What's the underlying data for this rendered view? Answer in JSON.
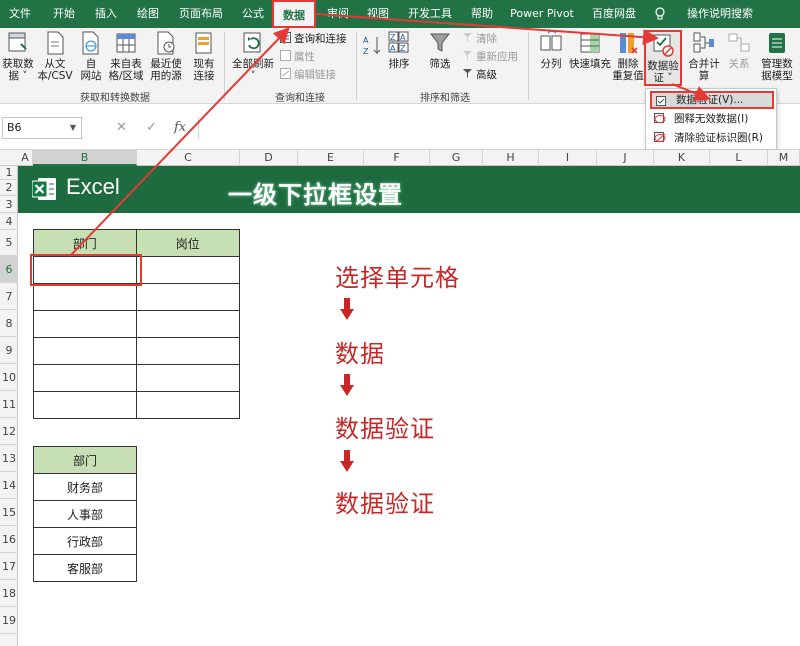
{
  "menu": {
    "tabs": [
      {
        "label": "文件",
        "active": false
      },
      {
        "label": "开始",
        "active": false
      },
      {
        "label": "插入",
        "active": false
      },
      {
        "label": "绘图",
        "active": false
      },
      {
        "label": "页面布局",
        "active": false
      },
      {
        "label": "公式",
        "active": false
      },
      {
        "label": "数据",
        "active": true
      },
      {
        "label": "审阅",
        "active": false
      },
      {
        "label": "视图",
        "active": false
      },
      {
        "label": "开发工具",
        "active": false
      },
      {
        "label": "帮助",
        "active": false
      },
      {
        "label": "Power Pivot",
        "active": false
      },
      {
        "label": "百度网盘",
        "active": false
      },
      {
        "label": "操作说明搜索",
        "active": false
      }
    ]
  },
  "ribbon": {
    "get_data": {
      "line1": "获取数",
      "line2": "据 ˅"
    },
    "from_text": {
      "line1": "从文",
      "line2": "本/CSV"
    },
    "from_web": {
      "line1": "自",
      "line2": "网站"
    },
    "from_table": {
      "line1": "来自表",
      "line2": "格/区域"
    },
    "recent_sources": {
      "line1": "最近使",
      "line2": "用的源"
    },
    "existing_conn": {
      "line1": "现有",
      "line2": "连接"
    },
    "group_get": "获取和转换数据",
    "refresh_all": {
      "line1": "全部刷新",
      "line2": "˅"
    },
    "queries_conn": "查询和连接",
    "properties": "属性",
    "edit_links": "编辑链接",
    "group_queries": "查询和连接",
    "sort": "排序",
    "filter": "筛选",
    "clear": "清除",
    "reapply": "重新应用",
    "advanced": "高级",
    "group_sort": "排序和筛选",
    "split": "分列",
    "flash_fill": "快速填充",
    "remove_dup": {
      "line1": "删除",
      "line2": "重复值"
    },
    "data_validation": {
      "line1": "数据验",
      "line2": "证 ˅"
    },
    "consolidate": "合并计算",
    "relations": "关系",
    "data_model": {
      "line1": "管理数",
      "line2": "据模型"
    }
  },
  "dropdown": {
    "items": [
      {
        "label": "数据验证(V)...",
        "highlighted": true
      },
      {
        "label": "圈释无效数据(I)",
        "highlighted": false
      },
      {
        "label": "清除验证标识圈(R)",
        "highlighted": false
      }
    ]
  },
  "formula_bar": {
    "name_box": "B6",
    "cancel": "✕",
    "enter": "✓",
    "fx": "fx",
    "value": ""
  },
  "columns": [
    "A",
    "B",
    "C",
    "D",
    "E",
    "F",
    "G",
    "H",
    "I",
    "J",
    "K",
    "L",
    "M"
  ],
  "selected_column": "B",
  "rows": [
    "1",
    "2",
    "3",
    "4",
    "5",
    "6",
    "7",
    "8",
    "9",
    "10",
    "11",
    "12",
    "13",
    "14",
    "15",
    "16",
    "17",
    "18",
    "19"
  ],
  "selected_row": "6",
  "banner": {
    "brand": "Excel",
    "title": "一级下拉框设置"
  },
  "table1": {
    "headers": [
      "部门",
      "岗位"
    ],
    "rows": [
      [
        "",
        ""
      ],
      [
        "",
        ""
      ],
      [
        "",
        ""
      ],
      [
        "",
        ""
      ],
      [
        "",
        ""
      ],
      [
        "",
        ""
      ]
    ]
  },
  "table2": {
    "header": "部门",
    "items": [
      "财务部",
      "人事部",
      "行政部",
      "客服部"
    ]
  },
  "steps": [
    "选择单元格",
    "数据",
    "数据验证",
    "数据验证"
  ],
  "colors": {
    "excel_green": "#217346",
    "banner_green": "#1e6b3f",
    "header_fill": "#c6e0b4",
    "annotation_red": "#e53935",
    "step_text": "#c62828"
  }
}
